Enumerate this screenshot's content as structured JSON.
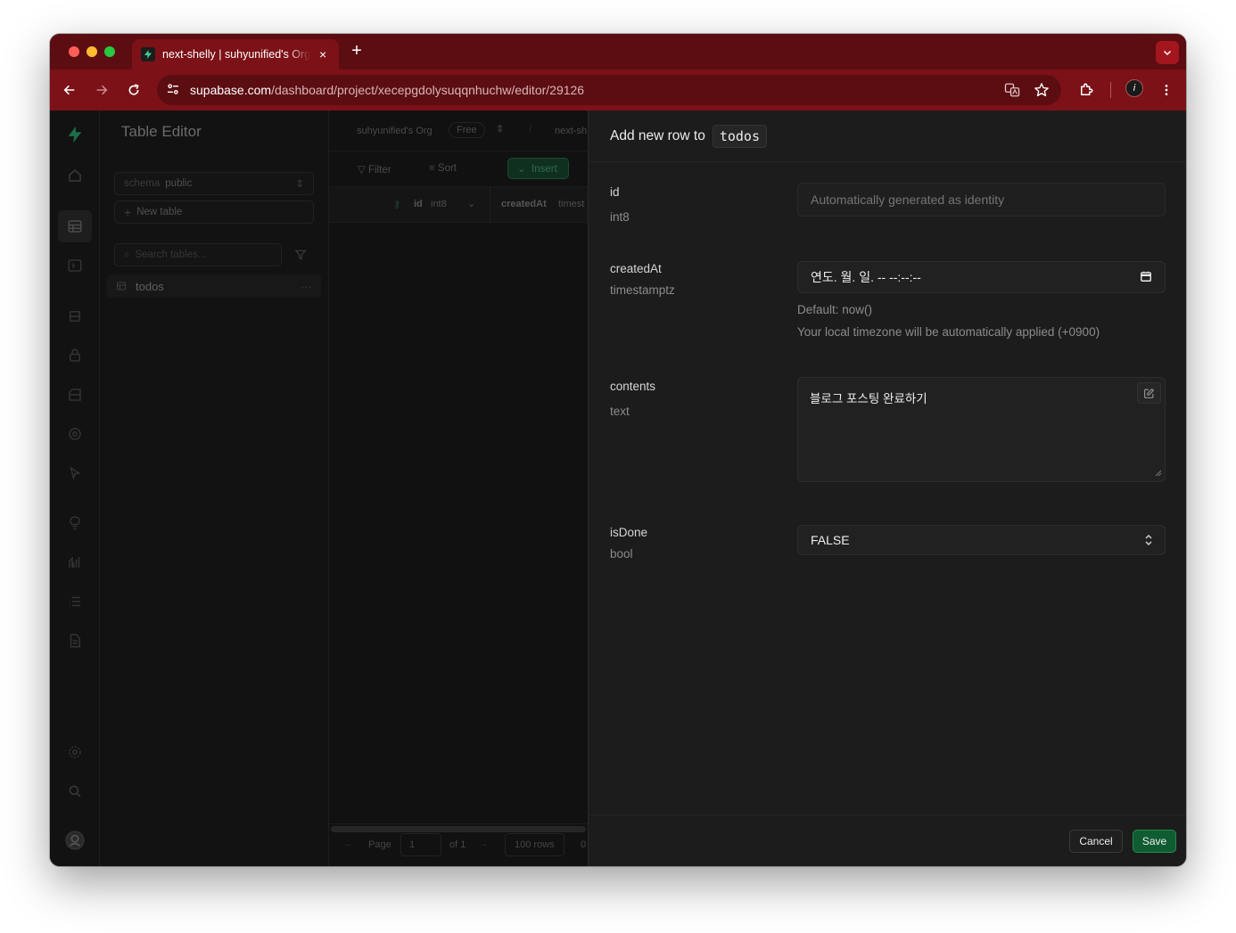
{
  "browser": {
    "tab_title": "next-shelly | suhyunified's Org",
    "new_tab": "+",
    "close": "×",
    "url_host": "supabase.com",
    "url_path": "/dashboard/project/xecepgdolysuqqnhuchw/editor/29126",
    "profile_initial": "i"
  },
  "sidebar": {
    "title": "Table Editor",
    "schema_label": "schema",
    "schema_value": "public",
    "new_table": "New table",
    "search_placeholder": "Search tables...",
    "table_item": "todos"
  },
  "grid": {
    "org": "suhyunified's Org",
    "plan": "Free",
    "project": "next-sh",
    "filter": "Filter",
    "sort": "Sort",
    "insert": "Insert",
    "col_id": "id",
    "col_id_type": "int8",
    "col_created": "createdAt",
    "col_created_type": "timest",
    "page_label": "Page",
    "page_value": "1",
    "of_label": "of 1",
    "rows_label": "100 rows",
    "trail": "0"
  },
  "panel": {
    "title": "Add new row to",
    "table": "todos",
    "fields": {
      "id": {
        "name": "id",
        "type": "int8",
        "placeholder": "Automatically generated as identity"
      },
      "createdAt": {
        "name": "createdAt",
        "type": "timestamptz",
        "value": "연도. 월. 일. -- --:--:--",
        "default_hint": "Default: now()",
        "tz_hint": "Your local timezone will be automatically applied (+0900)"
      },
      "contents": {
        "name": "contents",
        "type": "text",
        "value": "블로그 포스팅 완료하기"
      },
      "isDone": {
        "name": "isDone",
        "type": "bool",
        "value": "FALSE"
      }
    },
    "cancel": "Cancel",
    "save": "Save"
  },
  "colors": {
    "chrome_tabstrip": "#5c0d12",
    "chrome_toolbar": "#7c1117",
    "supabase_green": "#3ecf8e",
    "save_button": "#0f5c32"
  }
}
